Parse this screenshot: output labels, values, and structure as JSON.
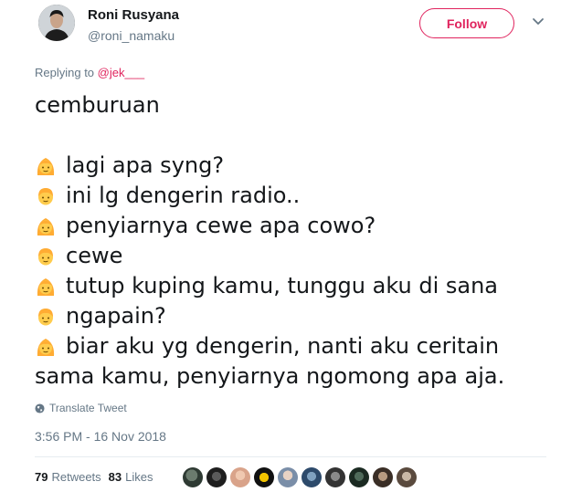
{
  "author": {
    "name": "Roni Rusyana",
    "handle": "@roni_namaku"
  },
  "follow": {
    "label": "Follow"
  },
  "reply": {
    "prefix": "Replying to ",
    "to": "@jek___"
  },
  "tweet": {
    "opening": "cemburuan",
    "lines": [
      {
        "emoji": "girl",
        "text": "lagi apa syng?"
      },
      {
        "emoji": "boy",
        "text": "ini lg dengerin radio.."
      },
      {
        "emoji": "girl",
        "text": "penyiarnya cewe apa cowo?"
      },
      {
        "emoji": "boy",
        "text": "cewe"
      },
      {
        "emoji": "girl",
        "text": "tutup kuping kamu, tunggu aku di sana"
      },
      {
        "emoji": "boy",
        "text": "ngapain?"
      },
      {
        "emoji": "girl",
        "text": "biar aku yg dengerin, nanti aku ceritain"
      },
      {
        "emoji": "",
        "text": "sama kamu, penyiarnya ngomong apa aja."
      }
    ]
  },
  "translate": {
    "label": "Translate Tweet"
  },
  "timestamp": "3:56 PM - 16 Nov 2018",
  "stats": {
    "retweets": "79",
    "retweets_label": "Retweets",
    "likes": "83",
    "likes_label": "Likes"
  },
  "colors": {
    "accent": "#e0245e",
    "muted": "#657786",
    "text": "#14171a",
    "emoji": "#ffcc4d"
  },
  "icons": {
    "menu": "chevron-down-icon",
    "translate": "globe-icon"
  }
}
